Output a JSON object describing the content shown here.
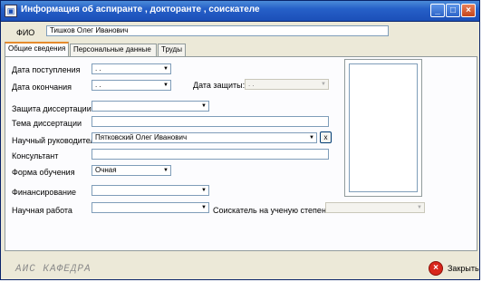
{
  "window": {
    "title": "Информация об аспиранте , докторанте , соискателе",
    "icon_name": "app-window-icon",
    "controls": {
      "minimize": "_",
      "maximize": "□",
      "close": "×"
    }
  },
  "fio": {
    "label": "ФИО",
    "value": "Тишков Олег Иванович"
  },
  "tabs": [
    {
      "label": "Общие сведения",
      "active": true
    },
    {
      "label": "Персональные данные",
      "active": false
    },
    {
      "label": "Труды",
      "active": false
    }
  ],
  "form": {
    "admission_date": {
      "label": "Дата поступления",
      "value": ". ."
    },
    "end_date": {
      "label": "Дата окончания",
      "value": ". ."
    },
    "defense_date": {
      "label": "Дата защиты:",
      "value": ". ."
    },
    "dissertation_defense": {
      "label": "Защита диссертации",
      "value": ""
    },
    "dissertation_topic": {
      "label": "Тема диссертации",
      "value": ""
    },
    "supervisor": {
      "label": "Научный руководитель",
      "value": "Пятковский Олег Иванович",
      "clear_label": "x"
    },
    "consultant": {
      "label": "Консультант",
      "value": ""
    },
    "study_form": {
      "label": "Форма обучения",
      "value": "Очная"
    },
    "financing": {
      "label": "Финансирование",
      "value": ""
    },
    "research_work": {
      "label": "Научная работа",
      "value": ""
    },
    "degree_applicant": {
      "label": "Соискатель на ученую степень",
      "value": ""
    }
  },
  "footer": {
    "brand": "АИС КАФЕДРА",
    "close_label": "Закрыть"
  },
  "colors": {
    "titlebar": "#2660c8",
    "window_bg": "#ece9d8",
    "close_red": "#d8261b",
    "active_tab_accent": "#e68b2c"
  }
}
